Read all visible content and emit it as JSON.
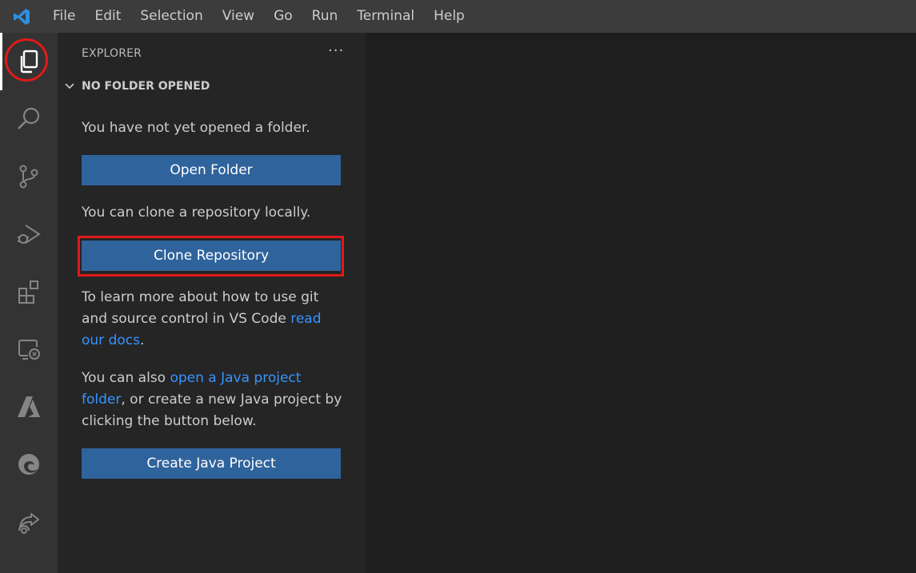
{
  "menubar": {
    "logo_icon": "vscode-logo-icon",
    "items": [
      "File",
      "Edit",
      "Selection",
      "View",
      "Go",
      "Run",
      "Terminal",
      "Help"
    ]
  },
  "activity_bar": {
    "items": [
      {
        "icon": "files-explorer-icon",
        "active": true
      },
      {
        "icon": "search-icon"
      },
      {
        "icon": "source-control-icon"
      },
      {
        "icon": "run-debug-icon"
      },
      {
        "icon": "extensions-icon"
      },
      {
        "icon": "remote-explorer-icon"
      },
      {
        "icon": "azure-icon"
      },
      {
        "icon": "edge-icon"
      },
      {
        "icon": "live-share-icon"
      }
    ]
  },
  "sidebar": {
    "title": "EXPLORER",
    "more_label": "···",
    "section_title": "NO FOLDER OPENED",
    "msg_no_folder": "You have not yet opened a folder.",
    "open_folder_button": "Open Folder",
    "msg_clone": "You can clone a repository locally.",
    "clone_button": "Clone Repository",
    "git_text_1": "To learn more about how to use git and source control in VS Code ",
    "git_link": "read our docs",
    "git_text_2": ".",
    "java_text_1": "You can also ",
    "java_link": "open a Java project folder",
    "java_text_2": ", or create a new Java project by clicking the button below.",
    "create_java_button": "Create Java Project"
  },
  "colors": {
    "highlight": "#e01a1a",
    "button": "#2f639c",
    "link": "#3794ff"
  }
}
